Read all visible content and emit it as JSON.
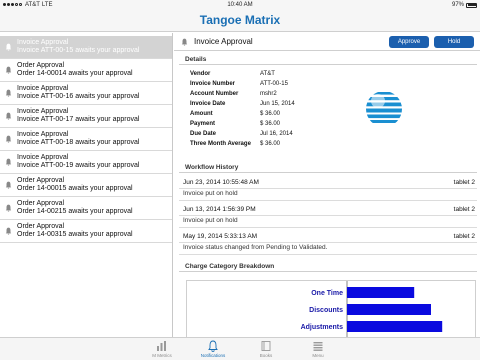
{
  "status_bar": {
    "carrier": "AT&T",
    "network": "LTE",
    "time": "10:40 AM",
    "battery": "97%"
  },
  "app": {
    "title": "Tangoe Matrix",
    "accent": "#1a6fb4"
  },
  "notifications": [
    {
      "title": "Invoice Approval",
      "subtitle": "Invoice ATT-00-15 awaits your approval",
      "selected": true
    },
    {
      "title": "Order Approval",
      "subtitle": "Order 14-00014 awaits your approval"
    },
    {
      "title": "Invoice Approval",
      "subtitle": "Invoice ATT-00-16 awaits your approval"
    },
    {
      "title": "Invoice Approval",
      "subtitle": "Invoice ATT-00-17 awaits your approval"
    },
    {
      "title": "Invoice Approval",
      "subtitle": "Invoice ATT-00-18 awaits your approval"
    },
    {
      "title": "Invoice Approval",
      "subtitle": "Invoice ATT-00-19 awaits your approval"
    },
    {
      "title": "Order Approval",
      "subtitle": "Order 14-00015 awaits your approval"
    },
    {
      "title": "Order Approval",
      "subtitle": "Order 14-00215 awaits your approval"
    },
    {
      "title": "Order Approval",
      "subtitle": "Order 14-00315 awaits your approval"
    }
  ],
  "detail": {
    "title": "Invoice Approval",
    "approve_label": "Approve",
    "hold_label": "Hold",
    "details_heading": "Details",
    "fields": [
      {
        "label": "Vendor",
        "value": "AT&T"
      },
      {
        "label": "Invoice Number",
        "value": "ATT-00-15"
      },
      {
        "label": "Account Number",
        "value": "mshr2"
      },
      {
        "label": "Invoice Date",
        "value": "Jun 15, 2014"
      },
      {
        "label": "Amount",
        "value": "$ 36.00"
      },
      {
        "label": "Payment",
        "value": "$ 36.00"
      },
      {
        "label": "Due Date",
        "value": "Jul 16, 2014"
      },
      {
        "label": "Three Month Average",
        "value": "$ 36.00"
      }
    ],
    "workflow_heading": "Workflow History",
    "workflow": [
      {
        "date": "Jun 23, 2014 10:55:48 AM",
        "source": "tablet 2",
        "note": "Invoice put on hold"
      },
      {
        "date": "Jun 13, 2014 1:56:39 PM",
        "source": "tablet 2",
        "note": "Invoice put on hold"
      },
      {
        "date": "May 19, 2014 5:33:13 AM",
        "source": "tablet 2",
        "note": "Invoice status changed from Pending to Validated."
      }
    ],
    "chart_heading": "Charge Category Breakdown"
  },
  "chart_data": {
    "type": "bar",
    "orientation": "horizontal",
    "categories": [
      "One Time",
      "Discounts",
      "Adjustments"
    ],
    "values": [
      6,
      7.5,
      8.5
    ],
    "bar_color": "#0a0adf",
    "label_color": "#1a1aa8",
    "xlim": [
      0,
      10
    ]
  },
  "tabs": [
    {
      "label": "M Metrics",
      "icon": "bar-chart-icon"
    },
    {
      "label": "Notifications",
      "icon": "bell-icon",
      "active": true
    },
    {
      "label": "Books",
      "icon": "book-icon"
    },
    {
      "label": "Menu",
      "icon": "list-icon"
    }
  ]
}
